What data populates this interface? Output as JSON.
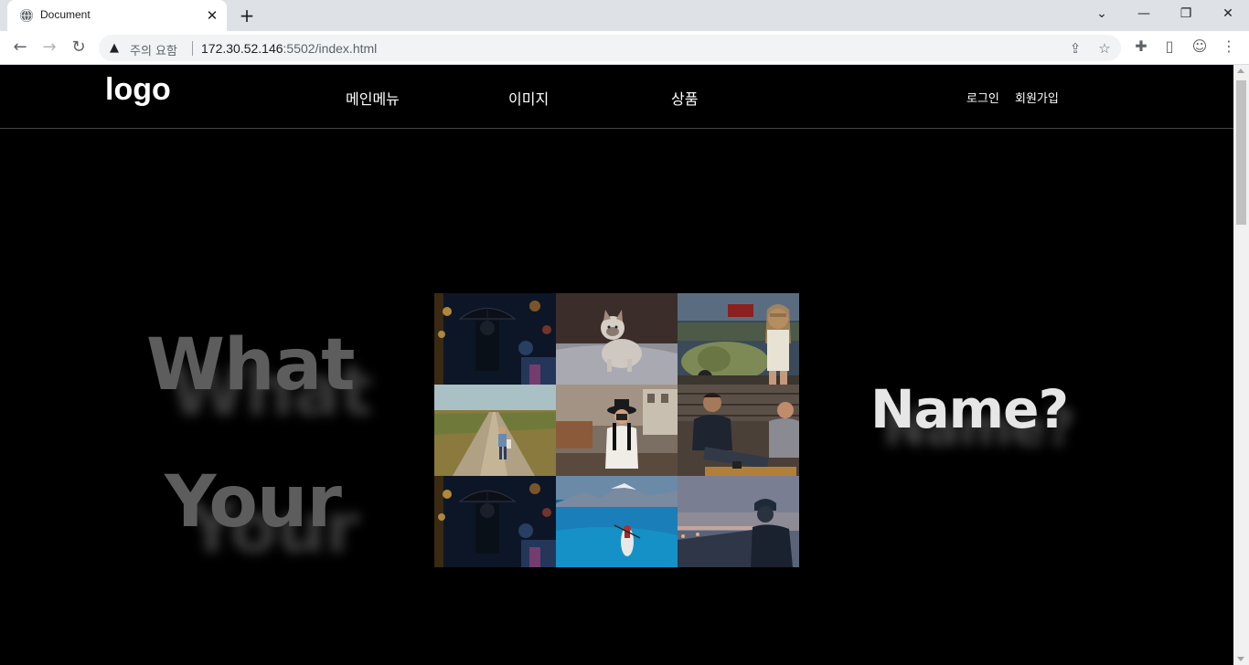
{
  "browser": {
    "tab_title": "Document",
    "security_label": "주의 요함",
    "url_host": "172.30.52.146",
    "url_rest": ":5502/index.html",
    "icons": [
      "globe-icon",
      "close-icon",
      "plus-icon",
      "chevron-down-icon",
      "minimize-icon",
      "restore-icon",
      "window-close-icon",
      "back-icon",
      "forward-icon",
      "reload-icon",
      "warning-icon",
      "share-icon",
      "star-icon",
      "extensions-icon",
      "side-panel-icon",
      "profile-icon",
      "menu-icon"
    ]
  },
  "header": {
    "logo": "logo",
    "nav": [
      "메인메뉴",
      "이미지",
      "상품"
    ],
    "login": "로그인",
    "signup": "회원가입"
  },
  "hero": {
    "word1": "What",
    "word2": "Your",
    "word3": "Name?"
  },
  "gallery": {
    "images": [
      "umbrella-street",
      "white-cat",
      "woman-vintage-car",
      "traveler-on-road",
      "woman-with-camera",
      "friends-laughing",
      "umbrella-street",
      "kayak-lake",
      "man-helmet-sunset"
    ]
  }
}
